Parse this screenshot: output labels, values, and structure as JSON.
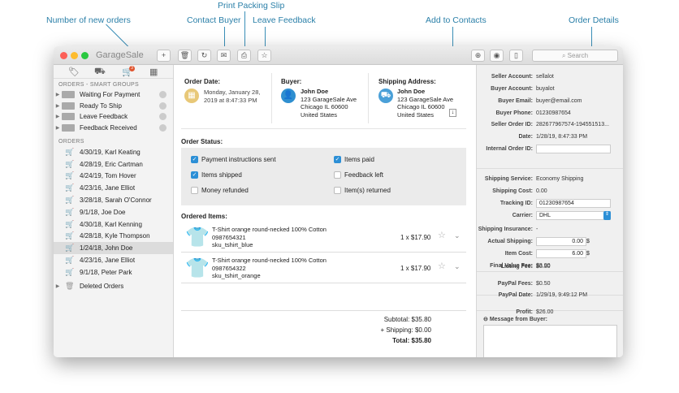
{
  "annotations": {
    "new_orders": "Number of new orders",
    "print_slip": "Print Packing Slip",
    "contact_buyer": "Contact Buyer",
    "leave_feedback": "Leave Feedback",
    "add_contacts": "Add to Contacts",
    "order_details": "Order Details"
  },
  "app": {
    "title": "GarageSale",
    "search_placeholder": "Search",
    "cart_badge": "3"
  },
  "sidebar": {
    "smart_header": "ORDERS - SMART GROUPS",
    "smart_groups": [
      "Waiting For Payment",
      "Ready To Ship",
      "Leave Feedback",
      "Feedback Received"
    ],
    "orders_header": "ORDERS",
    "orders": [
      "4/30/19, Karl Keating",
      "4/28/19, Eric Cartman",
      "4/24/19, Tom Hover",
      "4/23/16, Jane Elliot",
      "3/28/18, Sarah O'Connor",
      "9/1/18, Joe Doe",
      "4/30/18, Karl Kenning",
      "4/28/18, Kyle Thompson",
      "1/24/18, John Doe",
      "4/23/16, Jane Elliot",
      "9/1/18, Peter Park"
    ],
    "deleted": "Deleted Orders"
  },
  "main": {
    "order_date_label": "Order Date:",
    "order_date_1": "Monday, January 28,",
    "order_date_2": "2019 at 8:47:33 PM",
    "buyer_label": "Buyer:",
    "ship_label": "Shipping Address:",
    "name": "John Doe",
    "addr1": "123 GarageSale Ave",
    "addr2": "Chicago IL 60600",
    "addr3": "United States",
    "status_label": "Order Status:",
    "statuses": [
      {
        "label": "Payment instructions sent",
        "checked": true
      },
      {
        "label": "Items shipped",
        "checked": true
      },
      {
        "label": "Money refunded",
        "checked": false
      },
      {
        "label": "Items paid",
        "checked": true
      },
      {
        "label": "Feedback left",
        "checked": false
      },
      {
        "label": "Item(s) returned",
        "checked": false
      }
    ],
    "ordered_label": "Ordered Items:",
    "items": [
      {
        "title": "T-Shirt orange round-necked 100% Cotton",
        "id": "0987654321",
        "sku": "sku_tshirt_blue",
        "qty": "1 x $17.90",
        "color": "#2f8fd0"
      },
      {
        "title": "T-Shirt orange round-necked 100% Cotton",
        "id": "0987654322",
        "sku": "sku_tshirt_orange",
        "qty": "1 x $17.90",
        "color": "#c8783c"
      }
    ],
    "subtotal": "Subtotal: $35.80",
    "shipping": "+ Shipping: $0.00",
    "total": "Total: $35.80"
  },
  "details": {
    "seller_account_k": "Seller Account:",
    "seller_account": "sellalot",
    "buyer_account_k": "Buyer Account:",
    "buyer_account": "buyalot",
    "buyer_email_k": "Buyer Email:",
    "buyer_email": "buyer@email.com",
    "buyer_phone_k": "Buyer Phone:",
    "buyer_phone": "01230987654",
    "seller_order_k": "Seller Order ID:",
    "seller_order": "282677967574-194551513...",
    "date_k": "Date:",
    "date": "1/28/19, 8:47:33 PM",
    "internal_k": "Internal Order ID:",
    "internal": "",
    "service_k": "Shipping Service:",
    "service": "Economy Shipping",
    "ship_cost_k": "Shipping Cost:",
    "ship_cost": "0.00",
    "tracking_k": "Tracking ID:",
    "tracking": "01230987654",
    "carrier_k": "Carrier:",
    "carrier": "DHL",
    "insurance_k": "Shipping Insurance:",
    "insurance": "-",
    "actual_k": "Actual Shipping:",
    "actual": "0.00",
    "item_cost_k": "Item Cost:",
    "item_cost": "6.00",
    "currency": "$",
    "fvf_k": "Final Value Fee:",
    "fvf": "$3.00",
    "listing_k": "Listing Fee:",
    "listing": "$0.30",
    "paypal_fees_k": "PayPal Fees:",
    "paypal_fees": "$0.50",
    "paypal_date_k": "PayPal Date:",
    "paypal_date": "1/29/19, 9:49:12 PM",
    "profit_k": "Profit:",
    "profit": "$26.00",
    "message_label": "Message from Buyer:"
  }
}
